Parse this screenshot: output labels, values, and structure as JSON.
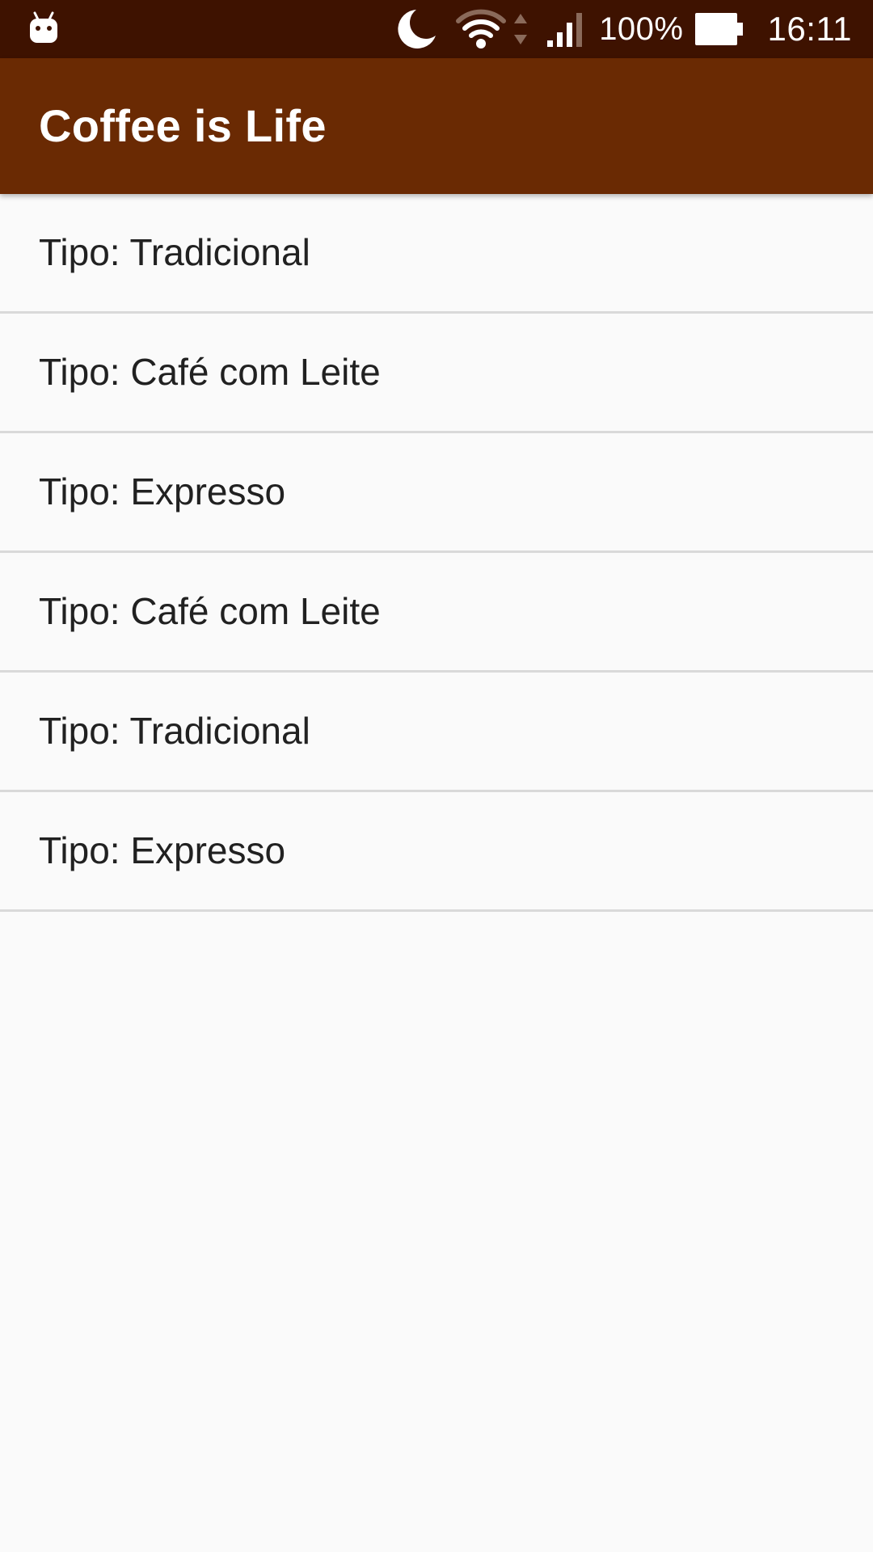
{
  "status_bar": {
    "notification_icon": "android-robot-icon",
    "icons": [
      "moon-icon",
      "wifi-icon",
      "data-arrows-icon",
      "cell-signal-icon",
      "battery-icon"
    ],
    "battery_percent": "100%",
    "time": "16:11"
  },
  "app_bar": {
    "title": "Coffee is Life"
  },
  "colors": {
    "status_bar": "#3e1200",
    "app_bar": "#6a2a03",
    "background": "#fafafa",
    "divider": "#d9d9d9",
    "text": "#212121"
  },
  "list": {
    "items": [
      {
        "label": "Tipo: Tradicional"
      },
      {
        "label": "Tipo: Café com Leite"
      },
      {
        "label": "Tipo: Expresso"
      },
      {
        "label": "Tipo: Café com Leite"
      },
      {
        "label": "Tipo: Tradicional"
      },
      {
        "label": "Tipo: Expresso"
      }
    ]
  }
}
